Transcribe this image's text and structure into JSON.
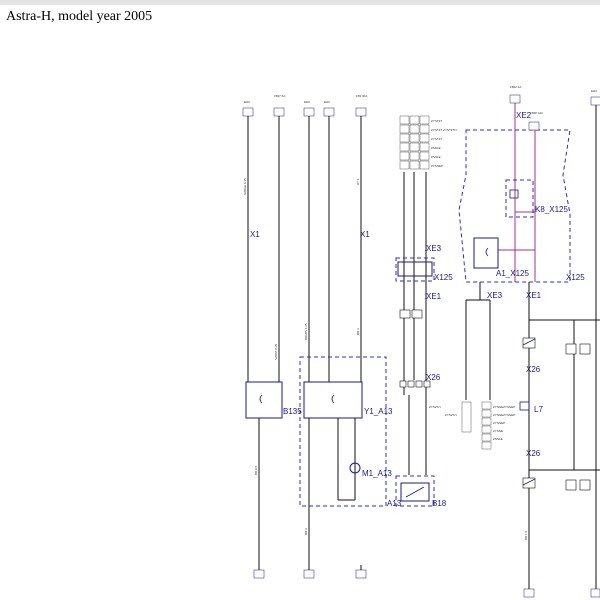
{
  "header": {
    "title": "Astra-H, model year 2005"
  },
  "colors": {
    "wire": "#111111",
    "component": "#1a1a8c",
    "dashed": "#2b2bd6",
    "magenta": "#a0309a"
  },
  "components": {
    "b135": "B135",
    "y1": "Y1_A13",
    "a13": "A13",
    "m1": "M1_A13",
    "b18": "B18",
    "a1": "A1_X125",
    "k8": "K8_X125",
    "x125a": "X125",
    "x125b": "X125",
    "l7": "L7"
  },
  "connectors": {
    "x1_left": "X1",
    "x1_mid": "X1",
    "xe3_top": "XE3",
    "xe1_top": "XE1",
    "xe2": "XE2",
    "xe3_bot": "XE3",
    "xe1_bot": "XE1",
    "x26_a": "X26",
    "x26_b": "X26",
    "x26_c": "X26"
  },
  "terminals": [
    "EDC",
    "F837",
    "EDC",
    "EDC",
    "F83",
    "F822",
    "EDC"
  ],
  "fuses": {
    "f837": "F837 5A",
    "f83": "F83 30A",
    "f822": "F822 3A",
    "f838": "F838 10A"
  },
  "wires": {
    "w1": "SW/GE 0.35",
    "w2": "RT 4",
    "w3": "BR/WS 0.35",
    "w4": "BR 4",
    "w5": "SW/RT 0.35",
    "w6": "BR 0.5",
    "w7": "BR 1.5",
    "w8": "BR 4"
  },
  "signals": {
    "s1": "ZYSTZT",
    "s2": "ZYSTZT ZYSTZTN",
    "s3": "ZYSTZT",
    "s4": "ZSN1E",
    "s5": "ZSN1E",
    "s6": "ZYSNEP",
    "s7": "ZYNNEZYSNEP",
    "s8": "ZYNNEZYSNEP",
    "s9": "ZYNNEP",
    "s10": "ZYSNE",
    "s11": "ZSN1E",
    "s12": "ZYSZTN",
    "s13": "ZYSZT ZYSZTN",
    "s14": "ZYSZTN"
  }
}
